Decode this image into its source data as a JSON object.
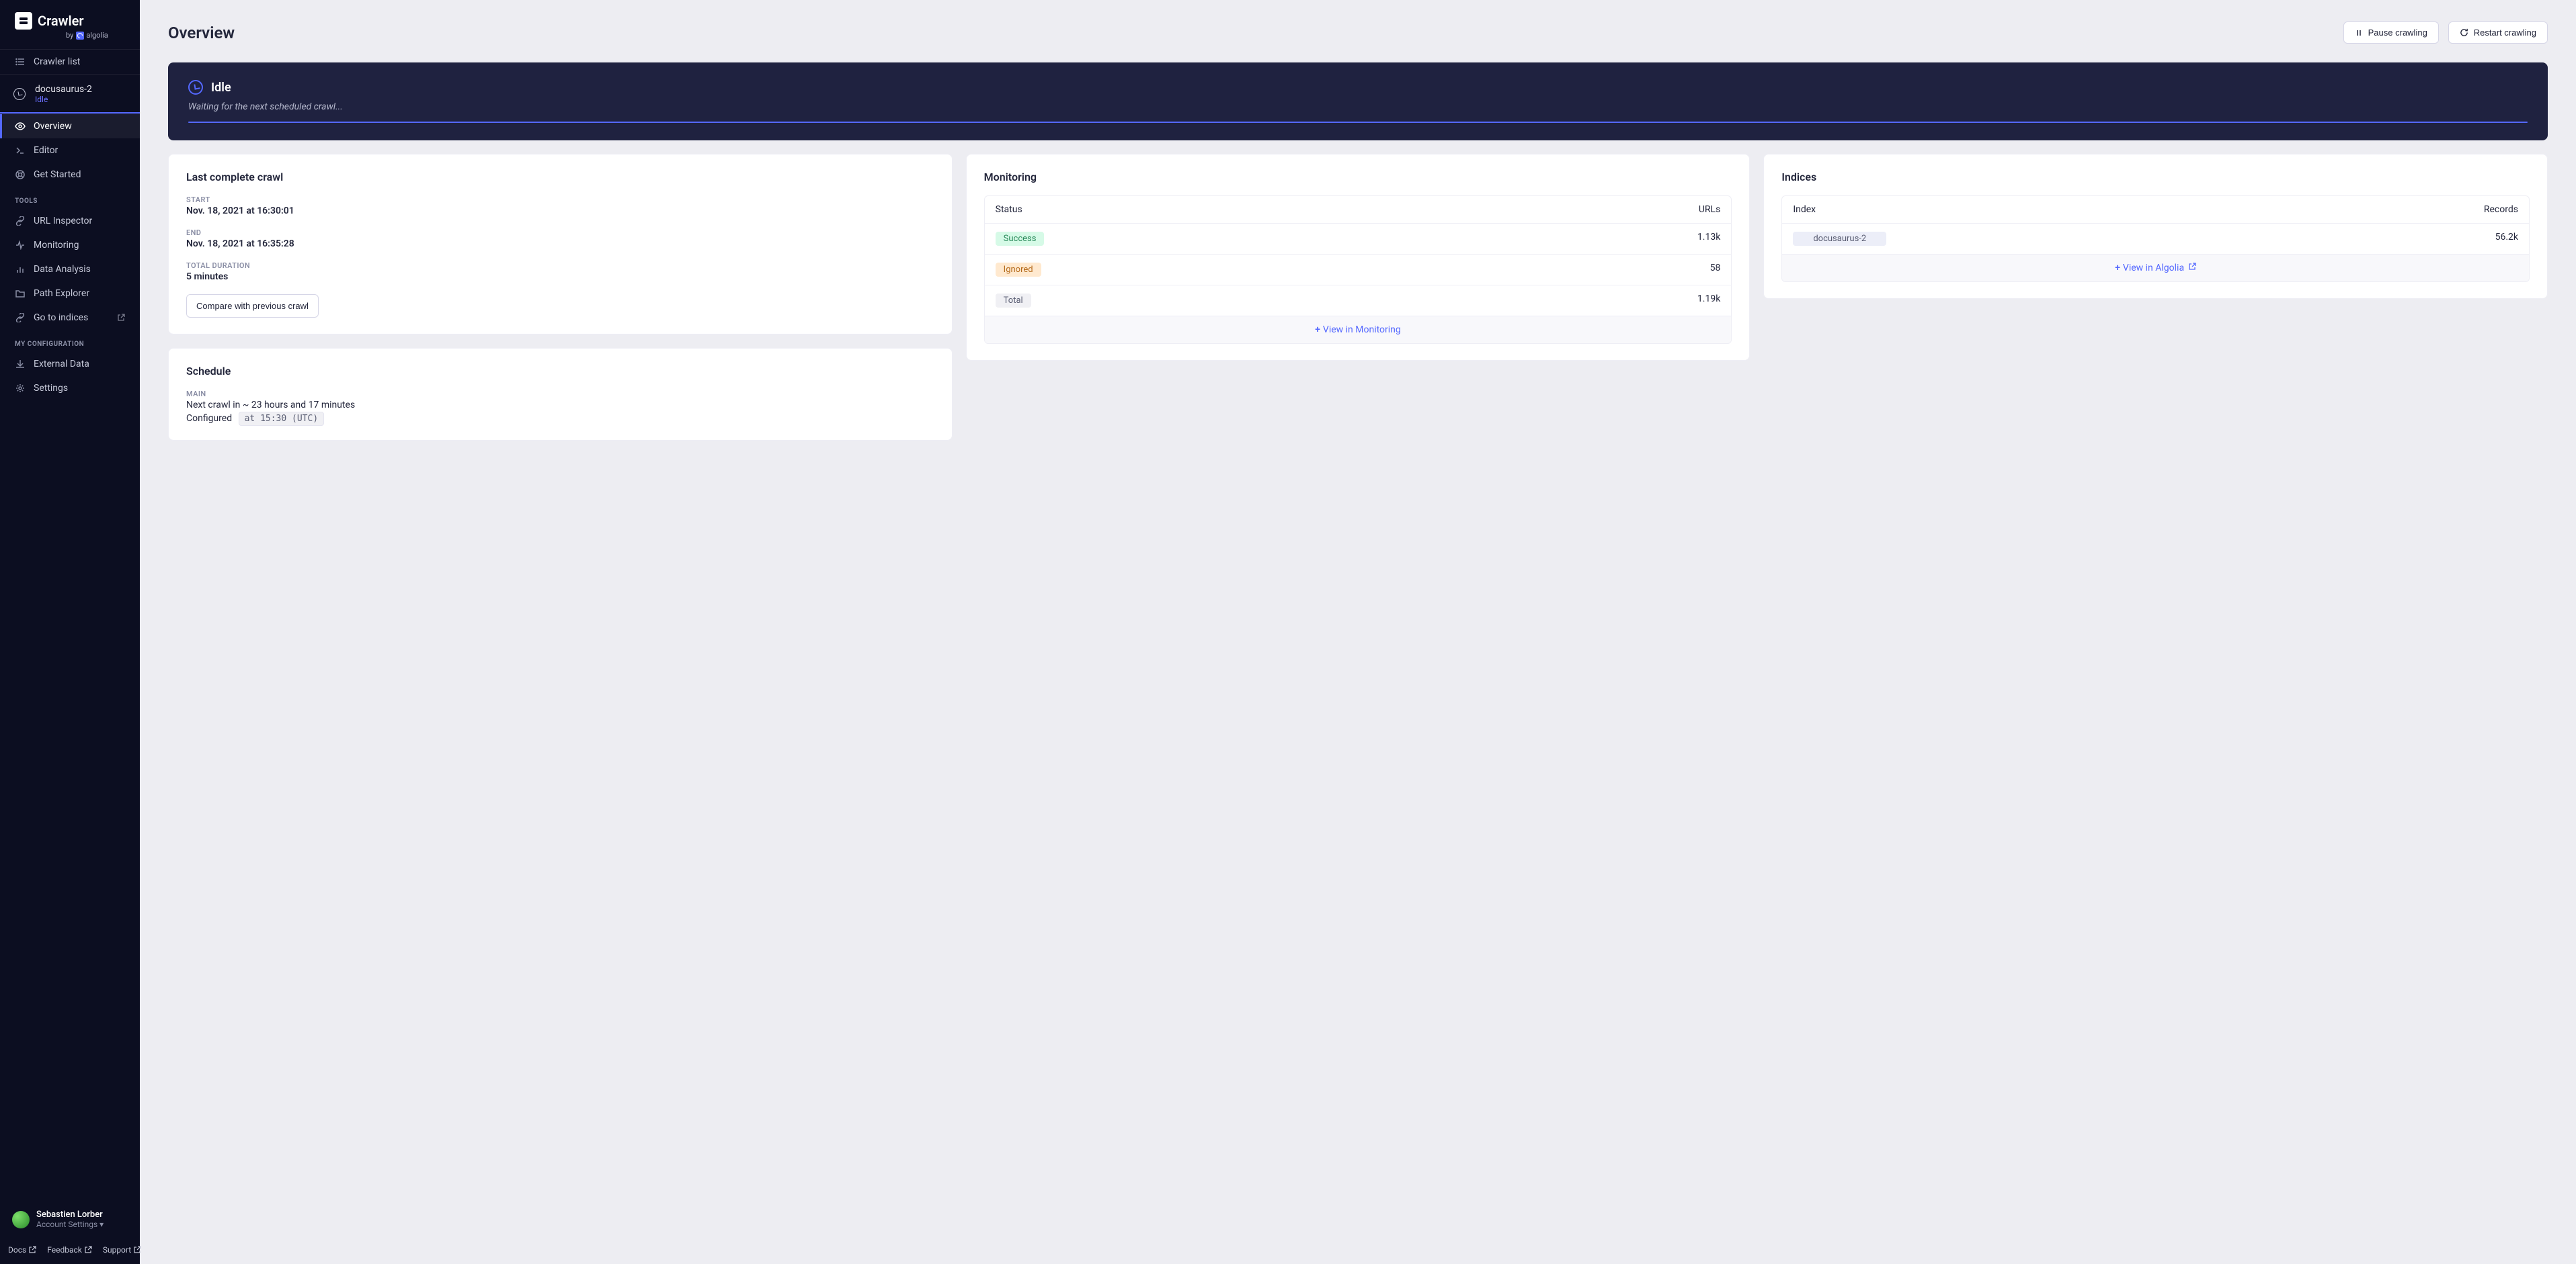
{
  "brand": {
    "name": "Crawler",
    "by": "by",
    "vendor": "algolia"
  },
  "sidebar": {
    "crawler_list": "Crawler list",
    "crawler": {
      "name": "docusaurus-2",
      "status": "Idle"
    },
    "nav": {
      "overview": "Overview",
      "editor": "Editor",
      "get_started": "Get Started"
    },
    "tools_heading": "TOOLS",
    "tools": {
      "url_inspector": "URL Inspector",
      "monitoring": "Monitoring",
      "data_analysis": "Data Analysis",
      "path_explorer": "Path Explorer",
      "go_to_indices": "Go to indices"
    },
    "config_heading": "MY CONFIGURATION",
    "config": {
      "external_data": "External Data",
      "settings": "Settings"
    }
  },
  "user": {
    "name": "Sebastien Lorber",
    "acct": "Account Settings ▾"
  },
  "footer": {
    "docs": "Docs",
    "feedback": "Feedback",
    "support": "Support"
  },
  "header": {
    "title": "Overview",
    "pause": "Pause crawling",
    "restart": "Restart crawling"
  },
  "status": {
    "state": "Idle",
    "message": "Waiting for the next scheduled crawl..."
  },
  "last_crawl": {
    "title": "Last complete crawl",
    "start_label": "START",
    "start_value": "Nov. 18, 2021 at 16:30:01",
    "end_label": "END",
    "end_value": "Nov. 18, 2021 at 16:35:28",
    "duration_label": "TOTAL DURATION",
    "duration_value": "5 minutes",
    "compare": "Compare with previous crawl"
  },
  "monitoring": {
    "title": "Monitoring",
    "col_status": "Status",
    "col_urls": "URLs",
    "rows": {
      "success_label": "Success",
      "success_value": "1.13k",
      "ignored_label": "Ignored",
      "ignored_value": "58",
      "total_label": "Total",
      "total_value": "1.19k"
    },
    "view": "View in Monitoring"
  },
  "indices": {
    "title": "Indices",
    "col_index": "Index",
    "col_records": "Records",
    "rows": {
      "index_name": "docusaurus-2",
      "records": "56.2k"
    },
    "view": "View in Algolia"
  },
  "schedule": {
    "title": "Schedule",
    "main_label": "MAIN",
    "next": "Next crawl in ~ 23 hours and 17 minutes",
    "configured": "Configured",
    "code": "at 15:30 (UTC)"
  }
}
